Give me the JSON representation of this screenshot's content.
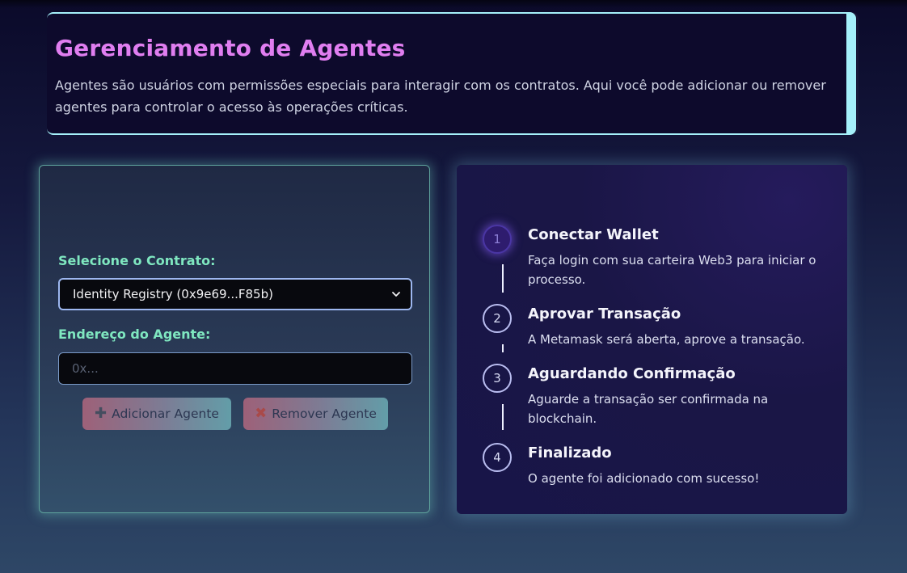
{
  "header": {
    "title": "Gerenciamento de Agentes",
    "description": "Agentes são usuários com permissões especiais para interagir com os contratos. Aqui você pode adicionar ou remover agentes para controlar o acesso às operações críticas."
  },
  "form": {
    "contract_label": "Selecione o Contrato:",
    "contract_selected": "Identity Registry (0x9e69...F85b)",
    "agent_label": "Endereço do Agente:",
    "agent_placeholder": "0x...",
    "add_button": "Adicionar Agente",
    "remove_button": "Remover Agente",
    "add_icon": "plus-icon",
    "remove_icon": "x-icon"
  },
  "steps": [
    {
      "number": "1",
      "title": "Conectar Wallet",
      "description": "Faça login com sua carteira Web3 para iniciar o processo.",
      "active": true
    },
    {
      "number": "2",
      "title": "Aprovar Transação",
      "description": "A Metamask será aberta, aprove a transação.",
      "active": false
    },
    {
      "number": "3",
      "title": "Aguardando Confirmação",
      "description": "Aguarde a transação ser confirmada na blockchain.",
      "active": false
    },
    {
      "number": "4",
      "title": "Finalizado",
      "description": "O agente foi adicionado com sucesso!",
      "active": false
    }
  ],
  "colors": {
    "title": "#e07ef0",
    "label": "#7fe7c0",
    "accent_border": "#a5f0fa",
    "active_step": "#2e1c6e"
  }
}
